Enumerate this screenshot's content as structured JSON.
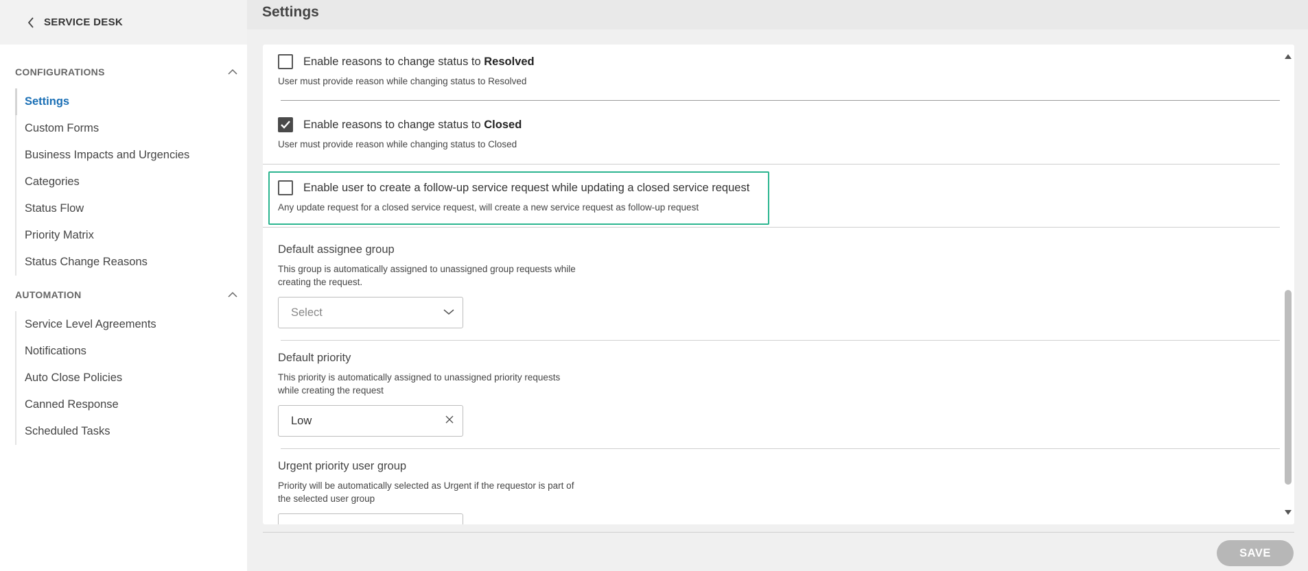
{
  "sidebar": {
    "back_label": "SERVICE DESK",
    "sections": [
      {
        "title": "CONFIGURATIONS",
        "items": [
          "Settings",
          "Custom Forms",
          "Business Impacts and Urgencies",
          "Categories",
          "Status Flow",
          "Priority Matrix",
          "Status Change Reasons"
        ]
      },
      {
        "title": "AUTOMATION",
        "items": [
          "Service Level Agreements",
          "Notifications",
          "Auto Close Policies",
          "Canned Response",
          "Scheduled Tasks"
        ]
      }
    ],
    "active_item": "Settings"
  },
  "header": {
    "title": "Settings"
  },
  "settings": {
    "resolved": {
      "label_prefix": "Enable reasons to change status to ",
      "label_strong": "Resolved",
      "checked": false,
      "help": "User must provide reason while changing status to Resolved"
    },
    "closed": {
      "label_prefix": "Enable reasons to change status to ",
      "label_strong": "Closed",
      "checked": true,
      "help": "User must provide reason while changing status to Closed"
    },
    "followup": {
      "label": "Enable user to create a follow-up service request while updating a closed service request",
      "checked": false,
      "help": "Any update request for a closed service request, will create a new service request as follow-up request"
    },
    "assignee_group": {
      "title": "Default assignee group",
      "help": "This group is automatically assigned to unassigned group requests while creating the request.",
      "placeholder": "Select"
    },
    "priority": {
      "title": "Default priority",
      "help": "This priority is automatically assigned to unassigned priority requests while creating the request",
      "value": "Low"
    },
    "urgent_group": {
      "title": "Urgent priority user group",
      "help": "Priority will be automatically selected as Urgent if the requestor is part of the selected user group"
    }
  },
  "footer": {
    "save_label": "SAVE"
  },
  "colors": {
    "accent": "#1a6fb5",
    "highlight": "#2bb58f",
    "save_disabled": "#b7b7b7"
  }
}
